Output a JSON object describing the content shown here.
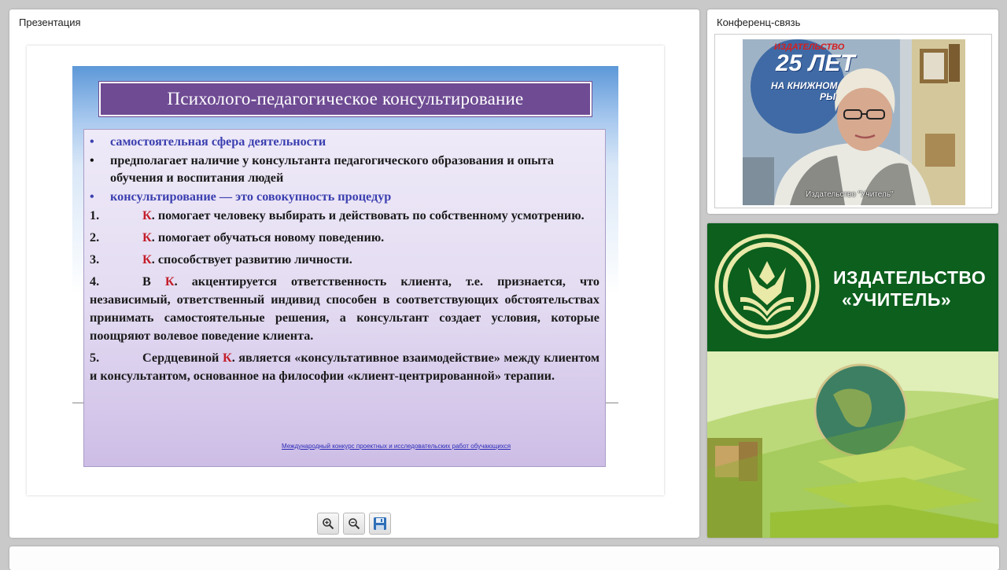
{
  "presentation": {
    "panel_title": "Презентация",
    "slide": {
      "title": "Психолого-педагогическое консультирование",
      "bullets": [
        "самостоятельная  сфера деятельности",
        "предполагает наличие у консультанта педагогического образования и опыта обучения и воспитания людей",
        "консультирование — это совокупность процедур"
      ],
      "bullet_mark": "•",
      "items": [
        {
          "num": "1.",
          "k": "К",
          "text": ". помогает человеку выбирать и действовать по собственному усмотрению."
        },
        {
          "num": "2.",
          "k": "К",
          "text": ". помогает обучаться новому поведению."
        },
        {
          "num": "3.",
          "k": "К",
          "text": ". способствует развитию личности."
        },
        {
          "num": "4.",
          "pre": "В ",
          "k": "К",
          "text": ". акцентируется ответственность клиента, т.е. признается, что независимый, ответственный индивид способен в соответствующих обстоятельствах принимать самостоятельные решения, а консультант создает условия, которые поощряют волевое поведение клиента."
        },
        {
          "num": "5.",
          "pre": "Сердцевиной ",
          "k": "К",
          "text": ". является «консультативное взаимодействие» между клиентом и консультантом, основанное на философии «клиент-центрированной» терапии."
        }
      ],
      "footer_link": "Международный конкурс проектных и исследовательских работ обучающихся"
    },
    "toolbar": {
      "zoom_in_icon": "zoom-in-icon",
      "zoom_out_icon": "zoom-out-icon",
      "save_icon": "save-icon"
    }
  },
  "conference": {
    "panel_title": "Конференц-связь",
    "video_caption": "Издательство \"Учитель\"",
    "backdrop_text_line1": "ИЗДАТЕЛЬСТВО",
    "backdrop_text_line2": "25 ЛЕТ",
    "backdrop_text_line3": "НА КНИЖНОМ",
    "backdrop_text_line4": "РЫ"
  },
  "banner": {
    "name_line1": "ИЗДАТЕЛЬСТВО",
    "name_line2": "«УЧИТЕЛЬ»"
  },
  "colors": {
    "slide_title_bg": "#6e4b93",
    "accent_k": "#c41e2a",
    "bullet_blue": "#3b3fb0",
    "banner_green": "#0c5f1d"
  }
}
